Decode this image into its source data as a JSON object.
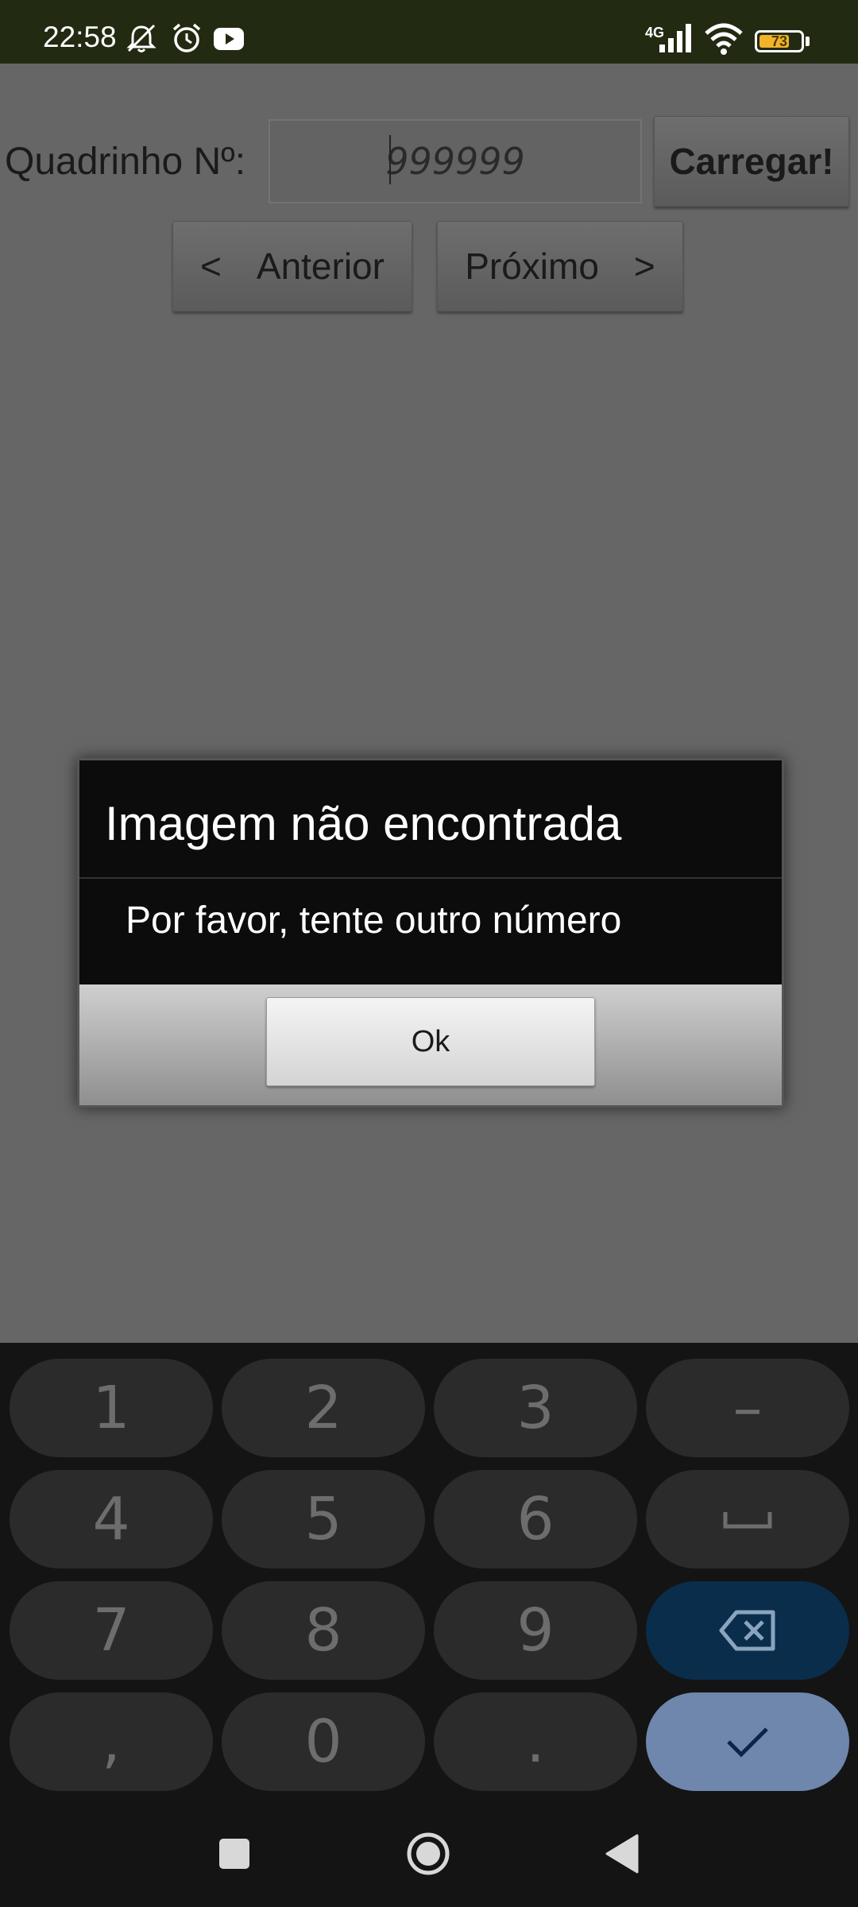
{
  "status_bar": {
    "time": "22:58",
    "network_type": "4G",
    "battery_percent": "73",
    "battery_level": 0.73,
    "icons": [
      "notifications-muted-icon",
      "alarm-icon",
      "youtube-icon",
      "signal-icon",
      "wifi-icon",
      "battery-icon"
    ]
  },
  "form": {
    "label": "Quadrinho Nº:",
    "input_value": "999999",
    "load_button": "Carregar!",
    "prev_button": "Anterior",
    "prev_arrow": "<",
    "next_button": "Próximo",
    "next_arrow": ">"
  },
  "dialog": {
    "title": "Imagem não encontrada",
    "message": "Por favor, tente outro número",
    "ok_button": "Ok"
  },
  "keyboard": {
    "keys": [
      "1",
      "2",
      "3",
      "–",
      "4",
      "5",
      "6",
      "␣",
      "7",
      "8",
      "9",
      "⌫",
      ",",
      "0",
      ".",
      "✓"
    ],
    "colors": {
      "key": "#2b2b2b",
      "backspace": "#0a2d4c",
      "done": "#6f86ad"
    }
  },
  "navigation": {
    "buttons": [
      "recents-icon",
      "home-icon",
      "back-icon"
    ]
  }
}
